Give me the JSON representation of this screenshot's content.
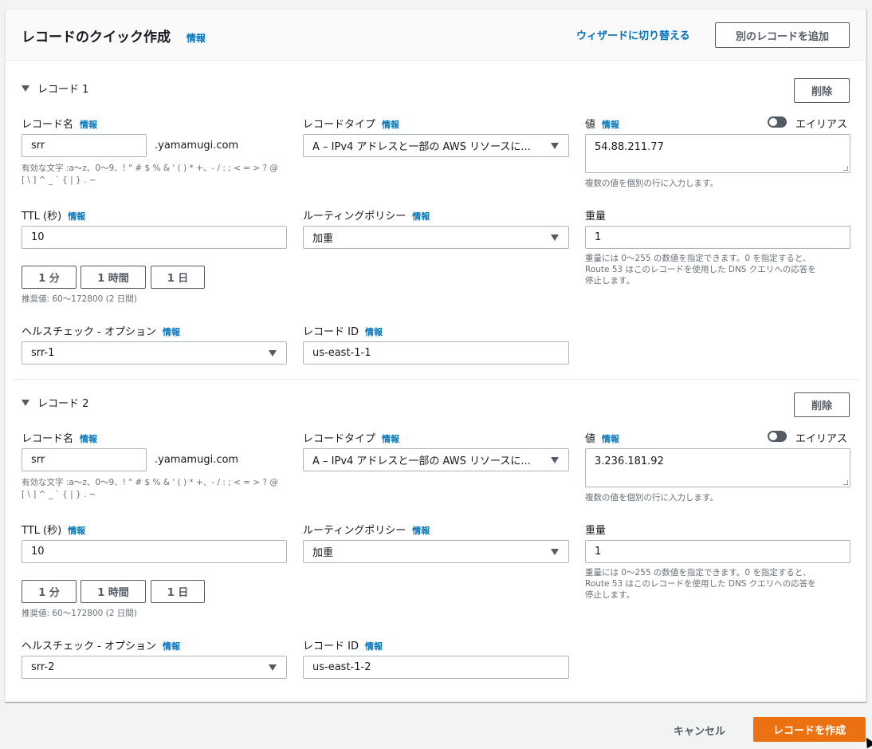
{
  "header": {
    "title": "レコードのクイック作成",
    "info": "情報",
    "wizard_link": "ウィザードに切り替える",
    "add_record_button": "別のレコードを追加"
  },
  "records": [
    {
      "heading": "レコード 1",
      "delete_button": "削除",
      "record_name_label": "レコード名",
      "record_name_value": "srr",
      "domain_suffix": ".yamamugi.com",
      "valid_chars_hint_1": "有効な文字 :a〜z、0〜9、! \" # $ % & ' ( ) * +、- / : ; < = > ? @",
      "valid_chars_hint_2": "[ \\ ] ^ _ ` { | } . ~",
      "record_type_label": "レコードタイプ",
      "record_type_value": "A – IPv4 アドレスと一部の AWS リソースに...",
      "value_label": "値",
      "alias_label": "エイリアス",
      "value_value": "54.88.211.77",
      "value_hint": "複数の値を個別の行に入力します。",
      "ttl_label": "TTL (秒)",
      "ttl_value": "10",
      "ttl_btn_1m": "1 分",
      "ttl_btn_1h": "1 時間",
      "ttl_btn_1d": "1 日",
      "ttl_hint": "推奨値: 60〜172800 (2 日間)",
      "routing_label": "ルーティングポリシー",
      "routing_value": "加重",
      "weight_label": "重量",
      "weight_value": "1",
      "weight_hint_1": "重量には 0〜255 の数値を指定できます。0 を指定すると、",
      "weight_hint_2": "Route 53 はこのレコードを使用した DNS クエリへの応答を",
      "weight_hint_3": "停止します。",
      "health_label": "ヘルスチェック - オプション",
      "health_value": "srr-1",
      "record_id_label": "レコード ID",
      "record_id_value": "us-east-1-1"
    },
    {
      "heading": "レコード 2",
      "delete_button": "削除",
      "record_name_label": "レコード名",
      "record_name_value": "srr",
      "domain_suffix": ".yamamugi.com",
      "valid_chars_hint_1": "有効な文字 :a〜z、0〜9、! \" # $ % & ' ( ) * +、- / : ; < = > ? @",
      "valid_chars_hint_2": "[ \\ ] ^ _ ` { | } . ~",
      "record_type_label": "レコードタイプ",
      "record_type_value": "A – IPv4 アドレスと一部の AWS リソースに...",
      "value_label": "値",
      "alias_label": "エイリアス",
      "value_value": "3.236.181.92",
      "value_hint": "複数の値を個別の行に入力します。",
      "ttl_label": "TTL (秒)",
      "ttl_value": "10",
      "ttl_btn_1m": "1 分",
      "ttl_btn_1h": "1 時間",
      "ttl_btn_1d": "1 日",
      "ttl_hint": "推奨値: 60〜172800 (2 日間)",
      "routing_label": "ルーティングポリシー",
      "routing_value": "加重",
      "weight_label": "重量",
      "weight_value": "1",
      "weight_hint_1": "重量には 0〜255 の数値を指定できます。0 を指定すると、",
      "weight_hint_2": "Route 53 はこのレコードを使用した DNS クエリへの応答を",
      "weight_hint_3": "停止します。",
      "health_label": "ヘルスチェック - オプション",
      "health_value": "srr-2",
      "record_id_label": "レコード ID",
      "record_id_value": "us-east-1-2"
    }
  ],
  "footer": {
    "cancel": "キャンセル",
    "create": "レコードを作成"
  },
  "colors": {
    "link": "#0073bb",
    "primary": "#ec7211",
    "border": "#aab7b8",
    "background": "#f2f3f3"
  }
}
